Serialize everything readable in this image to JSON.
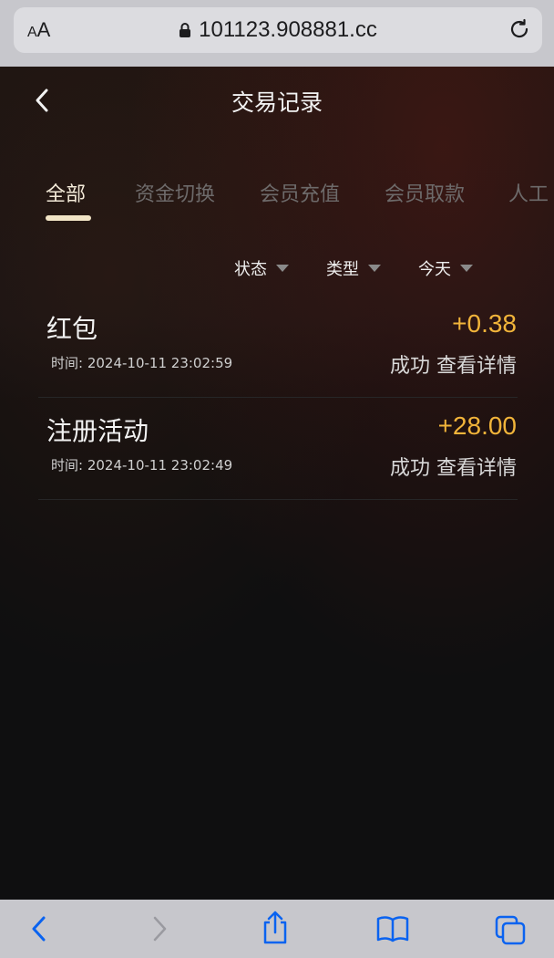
{
  "browser": {
    "aa_small": "A",
    "aa_large": "A",
    "url": "101123.908881.cc",
    "lock_icon": "lock-icon",
    "reload_icon": "reload-icon"
  },
  "header": {
    "back_icon": "chevron-left-icon",
    "title": "交易记录"
  },
  "tabs": [
    {
      "label": "全部",
      "active": true
    },
    {
      "label": "资金切换",
      "active": false
    },
    {
      "label": "会员充值",
      "active": false
    },
    {
      "label": "会员取款",
      "active": false
    },
    {
      "label": "人工",
      "active": false
    }
  ],
  "filters": [
    {
      "label": "状态"
    },
    {
      "label": "类型"
    },
    {
      "label": "今天"
    }
  ],
  "records": [
    {
      "title": "红包",
      "amount": "+0.38",
      "time_label": "时间:",
      "time": "2024-10-11 23:02:59",
      "status": "成功",
      "detail": "查看详情"
    },
    {
      "title": "注册活动",
      "amount": "+28.00",
      "time_label": "时间:",
      "time": "2024-10-11 23:02:49",
      "status": "成功",
      "detail": "查看详情"
    }
  ],
  "colors": {
    "accent_amount": "#f1b43a",
    "tab_active": "#f3ead8",
    "background": "#0f0f10"
  },
  "toolbar_icons": [
    "back-icon",
    "forward-icon",
    "share-icon",
    "bookmarks-icon",
    "tabs-icon"
  ]
}
